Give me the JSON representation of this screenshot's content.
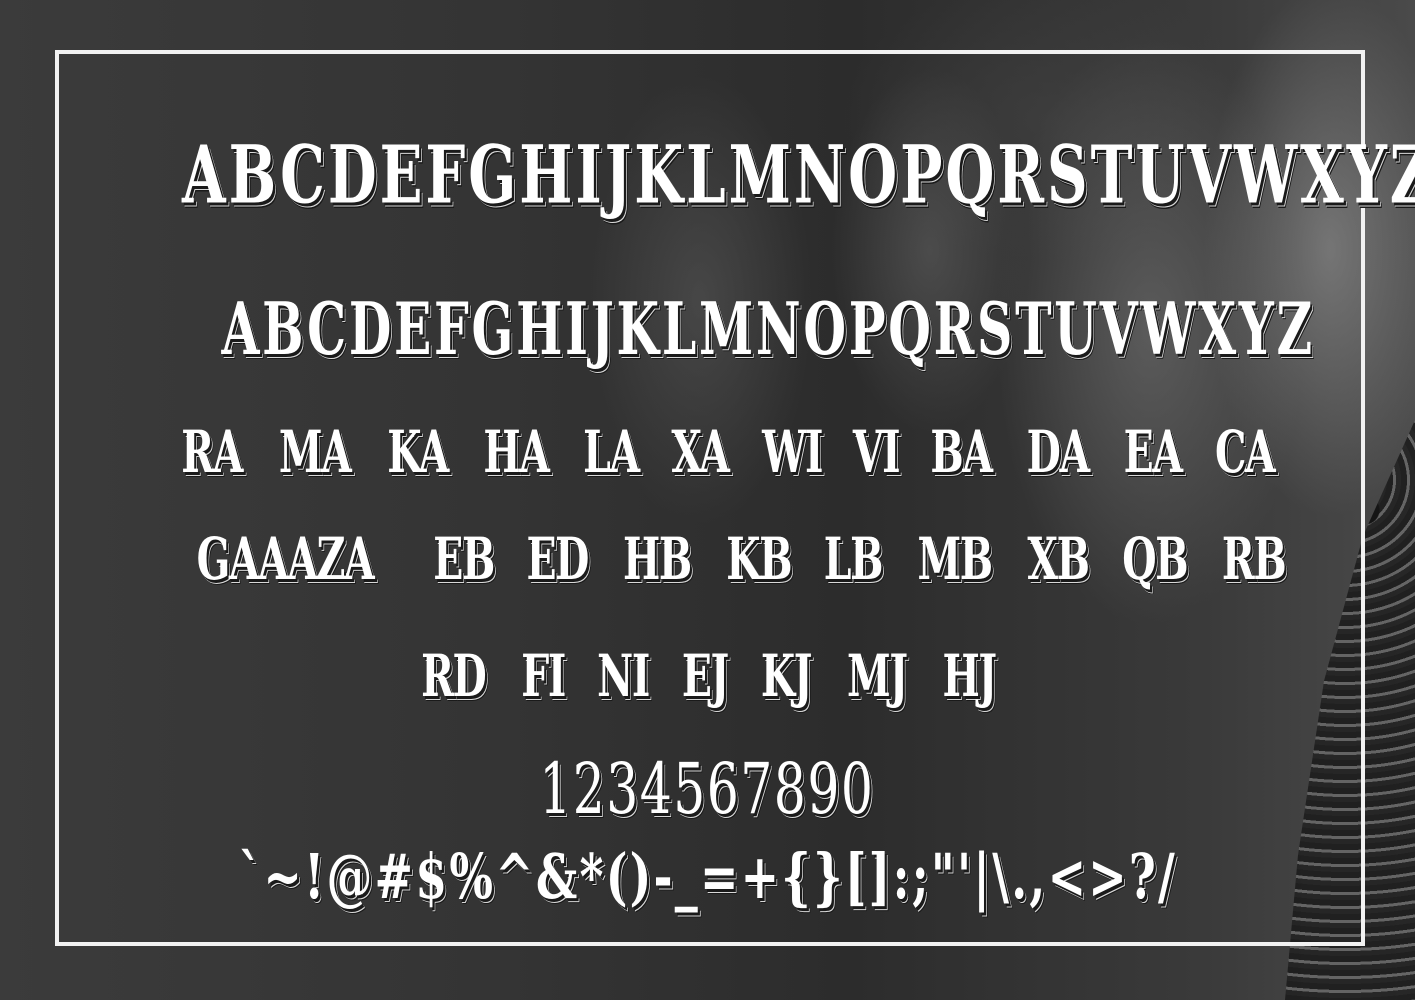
{
  "specimen": {
    "uppercase_alternate": "ABCDEFGHIJKLMNOPQRSTUVWXYZ",
    "uppercase_regular": "ABCDEFGHIJKLMNOPQRSTUVWXYZ",
    "ligatures_row_1": [
      "RA",
      "MA",
      "KA",
      "HA",
      "LA",
      "XA",
      "WI",
      "VI",
      "BA",
      "DA",
      "EA",
      "CA"
    ],
    "ligatures_row_2": [
      "GAAAZA",
      "EB",
      "ED",
      "HB",
      "KB",
      "LB",
      "MB",
      "XB",
      "QB",
      "RB"
    ],
    "ligatures_row_3": [
      "RD",
      "FI",
      "NI",
      "EJ",
      "KJ",
      "MJ",
      "HJ"
    ],
    "digits": "1234567890",
    "symbols": "`~!@#$%^&*()-_=+{}[]:;\"'|\\.,<>?/"
  },
  "colors": {
    "text": "#ffffff",
    "frame": "#f2f2f2",
    "background": "#2f2f2f"
  }
}
